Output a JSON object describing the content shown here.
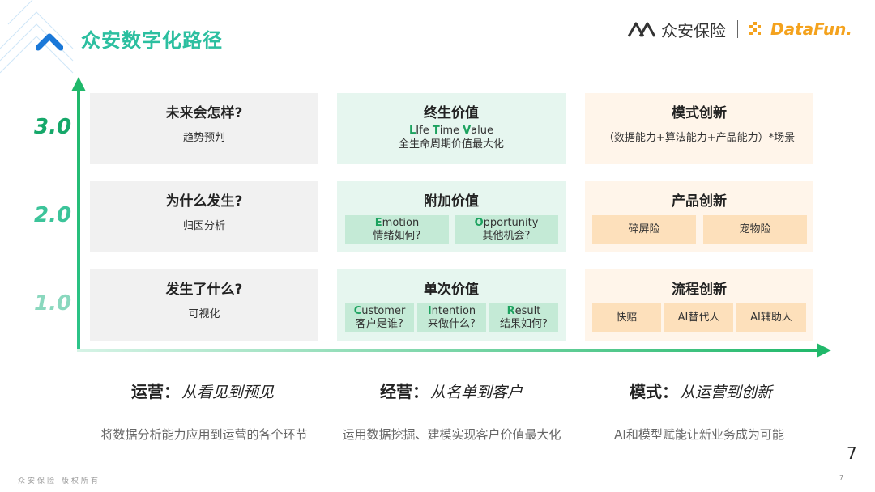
{
  "header": {
    "title": "众安数字化路径",
    "logo_za_text": "众安保险",
    "logo_df_text": "DataFun."
  },
  "y_axis": {
    "labels": [
      "3.0",
      "2.0",
      "1.0"
    ]
  },
  "rows": {
    "r3": {
      "col1": {
        "title": "未来会怎样?",
        "sub": "趋势预判"
      },
      "col2": {
        "title": "终生价值",
        "sub_line1_parts": [
          "L",
          "Ife ",
          "T",
          "ime ",
          "V",
          "alue"
        ],
        "sub_line2": "全生命周期价值最大化"
      },
      "col3": {
        "title": "模式创新",
        "sub": "（数据能力+算法能力+产品能力）*场景"
      }
    },
    "r2": {
      "col1": {
        "title": "为什么发生?",
        "sub": "归因分析"
      },
      "col2": {
        "title": "附加价值",
        "pills": [
          {
            "first": "E",
            "rest": "motion",
            "cn": "情绪如何?"
          },
          {
            "first": "O",
            "rest": "pportunity",
            "cn": "其他机会?"
          }
        ]
      },
      "col3": {
        "title": "产品创新",
        "pills": [
          "碎屏险",
          "宠物险"
        ]
      }
    },
    "r1": {
      "col1": {
        "title": "发生了什么?",
        "sub": "可视化"
      },
      "col2": {
        "title": "单次价值",
        "pills": [
          {
            "first": "C",
            "rest": "ustomer",
            "cn": "客户是谁?"
          },
          {
            "first": "I",
            "rest": "ntention",
            "cn": "来做什么?"
          },
          {
            "first": "R",
            "rest": "esult",
            "cn": "结果如何?"
          }
        ]
      },
      "col3": {
        "title": "流程创新",
        "pills": [
          "快赔",
          "AI替代人",
          "AI辅助人"
        ]
      }
    }
  },
  "bottom": [
    {
      "head": "运营：",
      "em": "从看见到预见",
      "desc": "将数据分析能力应用到运营的各个环节"
    },
    {
      "head": "经营：",
      "em": "从名单到客户",
      "desc": "运用数据挖掘、建模实现客户价值最大化"
    },
    {
      "head": "模式：",
      "em": "从运营到创新",
      "desc": "AI和模型赋能让新业务成为可能"
    }
  ],
  "page_number": "7",
  "page_number_small": "7",
  "footer": "众安保险  版权所有",
  "colors": {
    "accent_green": "#1ca25f",
    "title_teal": "#2cbfa0",
    "logo_orange": "#f4a21d"
  }
}
